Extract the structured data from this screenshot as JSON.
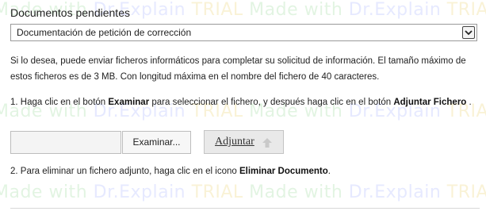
{
  "section": {
    "title": "Documentos pendientes"
  },
  "select": {
    "value": "Documentación de petición de corrección",
    "arrow_icon": "chevron-down-icon"
  },
  "info": {
    "text": "Si lo desea, puede enviar ficheros informáticos para completar su solicitud de información. El tamaño máximo de estos ficheros es de 3 MB. Con longitud máxima en el nombre del fichero de 40 caracteres."
  },
  "steps": {
    "step1": {
      "prefix": "1. Haga clic en el botón ",
      "bold1": "Examinar",
      "middle": " para seleccionar el fichero, y después haga clic en el botón ",
      "bold2": "Adjuntar Fichero",
      "suffix": " ."
    },
    "step2": {
      "prefix": "2. Para eliminar un fichero adjunto, haga clic en el icono ",
      "bold": "Eliminar Documento",
      "suffix": "."
    }
  },
  "upload": {
    "file_name_value": "",
    "browse_label": "Examinar...",
    "attach_label": "Adjuntar",
    "attach_icon": "arrow-up-icon"
  },
  "watermark": {
    "segment1": "Made with ",
    "segment2": "Dr.Explain ",
    "segment3": "TRIAL",
    "colors": [
      "#7fd07f",
      "#8fa0ff",
      "#e8c64a",
      "#ff9a9a"
    ]
  }
}
